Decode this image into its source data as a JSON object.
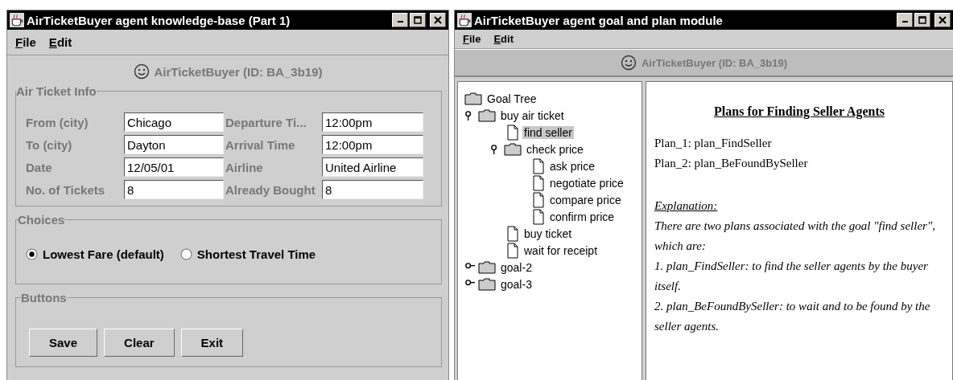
{
  "left_window": {
    "title": "AirTicketBuyer agent knowledge-base (Part 1)",
    "menu": [
      "File",
      "Edit"
    ],
    "agent_label": "AirTicketBuyer (ID: BA_3b19)",
    "ticket_info": {
      "legend": "Air Ticket Info",
      "fields": [
        {
          "label": "From (city)",
          "value": "Chicago"
        },
        {
          "label": "Departure Ti...",
          "value": "12:00pm"
        },
        {
          "label": "To (city)",
          "value": "Dayton"
        },
        {
          "label": "Arrival Time",
          "value": "12:00pm"
        },
        {
          "label": "Date",
          "value": "12/05/01"
        },
        {
          "label": "Airline",
          "value": "United Airline"
        },
        {
          "label": "No. of Tickets",
          "value": "8"
        },
        {
          "label": "Already Bought",
          "value": "8"
        }
      ]
    },
    "choices": {
      "legend": "Choices",
      "options": [
        {
          "label": "Lowest Fare (default)",
          "selected": true
        },
        {
          "label": "Shortest Travel Time",
          "selected": false
        }
      ]
    },
    "buttons": {
      "legend": "Buttons",
      "items": [
        "Save",
        "Clear",
        "Exit"
      ]
    }
  },
  "right_window": {
    "title": "AirTicketBuyer agent goal and plan module",
    "menu": [
      "File",
      "Edit"
    ],
    "agent_label": "AirTicketBuyer (ID: BA_3b19)",
    "tree": {
      "items": [
        {
          "label": "Goal Tree",
          "kind": "folder",
          "selected": false,
          "children": [
            {
              "label": "buy air ticket",
              "kind": "folder",
              "expanded": true,
              "selected": false,
              "children": [
                {
                  "label": "find seller",
                  "kind": "leaf",
                  "selected": true
                },
                {
                  "label": "check price",
                  "kind": "folder",
                  "expanded": true,
                  "selected": false,
                  "children": [
                    {
                      "label": "ask price",
                      "kind": "leaf",
                      "selected": false
                    },
                    {
                      "label": "negotiate price",
                      "kind": "leaf",
                      "selected": false
                    },
                    {
                      "label": "compare price",
                      "kind": "leaf",
                      "selected": false
                    },
                    {
                      "label": "confirm price",
                      "kind": "leaf",
                      "selected": false
                    }
                  ]
                },
                {
                  "label": "buy ticket",
                  "kind": "leaf",
                  "selected": false
                },
                {
                  "label": "wait for receipt",
                  "kind": "leaf",
                  "selected": false
                }
              ]
            },
            {
              "label": "goal-2",
              "kind": "folder",
              "expanded": false,
              "selected": false
            },
            {
              "label": "goal-3",
              "kind": "folder",
              "expanded": false,
              "selected": false
            }
          ]
        }
      ]
    },
    "plans": {
      "heading": "Plans for Finding Seller Agents",
      "plans": [
        "Plan_1: plan_FindSeller",
        "Plan_2: plan_BeFoundBySeller"
      ],
      "explanation_title": "Explanation:",
      "explanation": [
        "There are two plans associated with the goal \"find seller\", which are:",
        "1. plan_FindSeller: to find the seller agents by the buyer itself.",
        "2. plan_BeFoundBySeller: to wait and to be found by the seller agents."
      ]
    }
  }
}
